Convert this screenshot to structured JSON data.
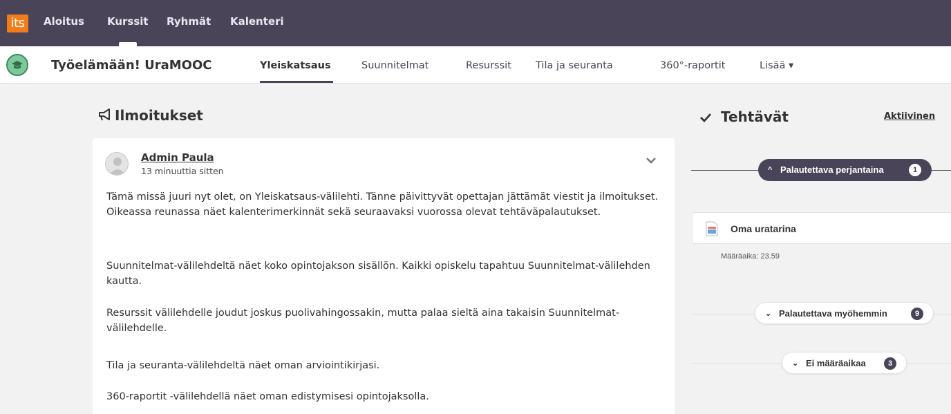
{
  "topbar": {
    "logo_text": "its",
    "nav": [
      "Aloitus",
      "Kurssit",
      "Ryhmät",
      "Kalenteri"
    ],
    "active_nav": "Kurssit"
  },
  "course": {
    "title": "Työelämään! UraMOOC",
    "tabs": [
      "Yleiskatsaus",
      "Suunnitelmat",
      "Resurssit",
      "Tila ja seuranta",
      "360°-raportit",
      "Lisää ▾"
    ],
    "active_tab": "Yleiskatsaus"
  },
  "announcements": {
    "heading": "Ilmoitukset",
    "post": {
      "author": "Admin Paula",
      "time": "13 minuuttia sitten",
      "paragraphs": [
        "Tämä missä juuri nyt olet, on Yleiskatsaus-välilehti. Tänne päivittyvät opettajan jättämät viestit ja ilmoitukset. Oikeassa reunassa näet kalenterimerkinnät sekä seuraavaksi vuorossa olevat tehtäväpalautukset.",
        "Suunnitelmat-välilehdeltä näet koko opintojakson sisällön. Kaikki opiskelu tapahtuu Suunnitelmat-välilehden kautta.",
        "Resurssit välilehdelle joudut joskus puolivahingossakin, mutta palaa sieltä aina takaisin Suunnitelmat-välilehdelle.",
        "Tila ja seuranta-välilehdeltä näet oman arviointikirjasi.",
        "360-raportit -välilehdellä näet oman edistymisesi opintojaksolla."
      ]
    }
  },
  "tasks": {
    "heading": "Tehtävät",
    "filter_link": "Aktiivinen",
    "groups": [
      {
        "label": "Palautettava perjantaina",
        "count": "1",
        "expanded": true,
        "chevron": "^"
      },
      {
        "label": "Palautettava myöhemmin",
        "count": "9",
        "expanded": false,
        "chevron": "⌄"
      },
      {
        "label": "Ei määräaikaa",
        "count": "3",
        "expanded": false,
        "chevron": "⌄"
      }
    ],
    "items": [
      {
        "title": "Oma uratarina",
        "deadline": "Määräaika: 23.59"
      }
    ]
  },
  "colors": {
    "topbar": "#4a4458",
    "logo": "#f07d1a",
    "course_icon": "#7dc99b",
    "page_background": "#f2f2f2"
  }
}
